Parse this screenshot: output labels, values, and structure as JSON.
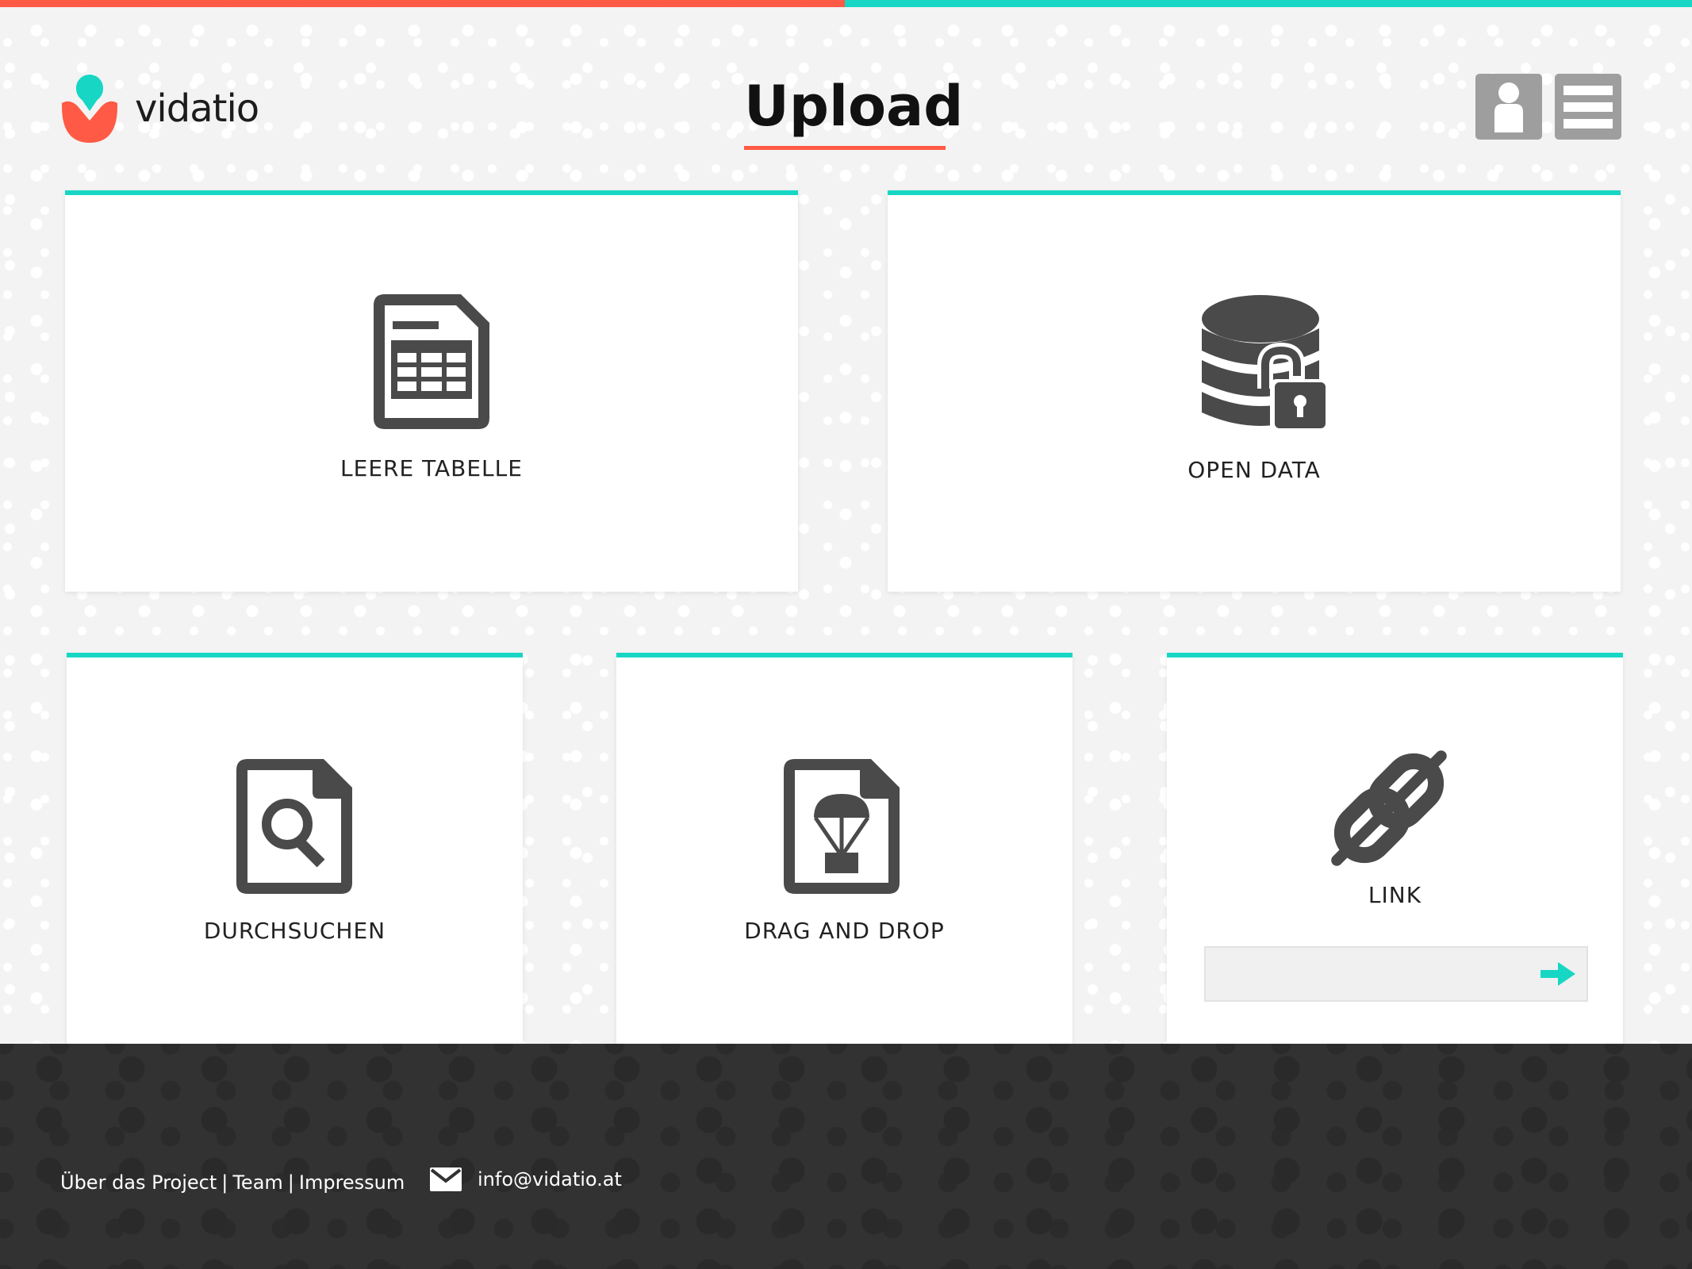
{
  "brand": {
    "name": "vidatio",
    "primary_color": "#ff5a45",
    "accent_color": "#18d6c4"
  },
  "header": {
    "title": "Upload",
    "user_icon": "user-icon",
    "menu_icon": "hamburger-menu-icon"
  },
  "cards": [
    {
      "id": "empty-table",
      "label": "LEERE TABELLE",
      "icon": "spreadsheet-file-icon"
    },
    {
      "id": "open-data",
      "label": "OPEN DATA",
      "icon": "database-unlocked-icon"
    },
    {
      "id": "browse",
      "label": "DURCHSUCHEN",
      "icon": "file-search-icon"
    },
    {
      "id": "drag-drop",
      "label": "DRAG AND DROP",
      "icon": "file-parachute-icon"
    },
    {
      "id": "link",
      "label": "LINK",
      "icon": "chain-link-icon",
      "input_value": "",
      "submit_icon": "arrow-right-icon"
    }
  ],
  "footer": {
    "links": [
      "Über das Project",
      "Team",
      "Impressum"
    ],
    "separator": "|",
    "email": "info@vidatio.at",
    "mail_icon": "envelope-icon"
  }
}
